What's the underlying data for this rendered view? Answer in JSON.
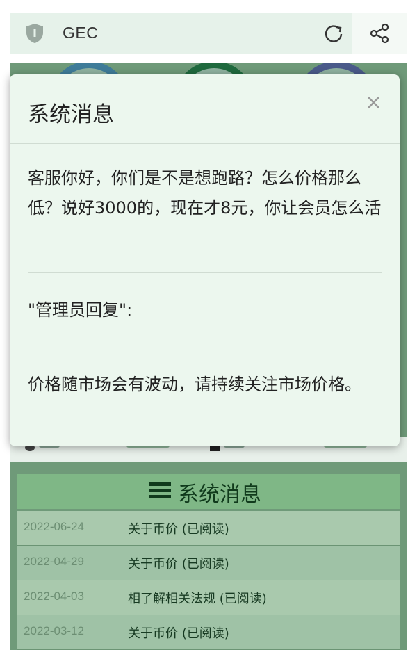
{
  "app": {
    "title": "GEC"
  },
  "modal": {
    "title": "系统消息",
    "close": "×",
    "message": "客服你好，你们是不是想跑路？怎么价格那么低？说好3000的，现在才8元，你让会员怎么活",
    "reply_label": "\"管理员回复\":",
    "reply": "价格随市场会有波动，请持续关注市场价格。"
  },
  "messages": {
    "header": "系统消息",
    "items": [
      {
        "date": "2022-06-24",
        "title": "关于币价 (已阅读)"
      },
      {
        "date": "2022-04-29",
        "title": "关于币价 (已阅读)"
      },
      {
        "date": "2022-04-03",
        "title": "相了解相关法规 (已阅读)"
      },
      {
        "date": "2022-03-12",
        "title": "关于币价 (已阅读)"
      }
    ]
  },
  "colors": {
    "header_bg": "#e6f2ea",
    "overlay": "#6f9a79",
    "modal_bg": "#ecf7ee",
    "accent": "#103a1c"
  },
  "icons": {
    "shield": "shield-icon",
    "refresh": "refresh-icon",
    "share": "share-icon",
    "close": "close-icon",
    "list": "list-icon"
  }
}
